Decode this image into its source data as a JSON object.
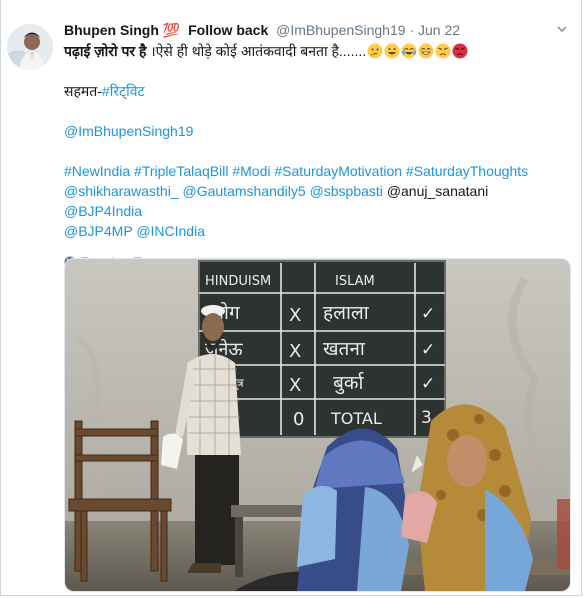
{
  "tweet": {
    "author_name": "Bhupen Singh",
    "author_emoji": "💯",
    "follow_back": "Follow back",
    "handle": "@ImBhupenSingh19",
    "separator": "·",
    "date": "Jun 22",
    "line1_bold": "पढ़ाई ज़ोरो पर है",
    "line1_rest": " ।ऐसे ही थोड़े कोई आतंकवादी बनता है.......",
    "emojis": [
      "thinking-face",
      "grinning-face",
      "tears-of-joy",
      "grinning-big-eyes",
      "angry-face",
      "pouting-face"
    ],
    "sahmat_prefix": "सहमत-",
    "retweet_tag": "#रिट्विट",
    "mention_self": "@ImBhupenSingh19",
    "hashtags": [
      "#NewIndia",
      "#TripleTalaqBill",
      "#Modi",
      "#SaturdayMotivation",
      "#SaturdayThoughts"
    ],
    "mentions_a": [
      "@shikharawasthi_",
      "@Gautamshandily5",
      "@sbspbasti"
    ],
    "plain_mention": "@anuj_sanatani",
    "mentions_b": [
      "@BJP4India",
      "@BJP4MP",
      "@INCIndia"
    ],
    "translate_label": "Translate Tweet"
  },
  "photo": {
    "board": {
      "headers": [
        "HINDUISM",
        "ISLAM"
      ],
      "rows": [
        {
          "left": "योग",
          "mark": "X",
          "right": "हलाला",
          "tick": "✓"
        },
        {
          "left": "जनेऊ",
          "mark": "X",
          "right": "खतना",
          "tick": "✓"
        },
        {
          "left": "मंगल सूत्र",
          "mark": "X",
          "right": "बुर्का",
          "tick": "✓"
        },
        {
          "left": "",
          "mark": "0",
          "right": "TOTAL",
          "tick": "3"
        }
      ]
    }
  },
  "colors": {
    "link": "#1b95e0",
    "muted": "#657786",
    "text": "#14171a"
  }
}
